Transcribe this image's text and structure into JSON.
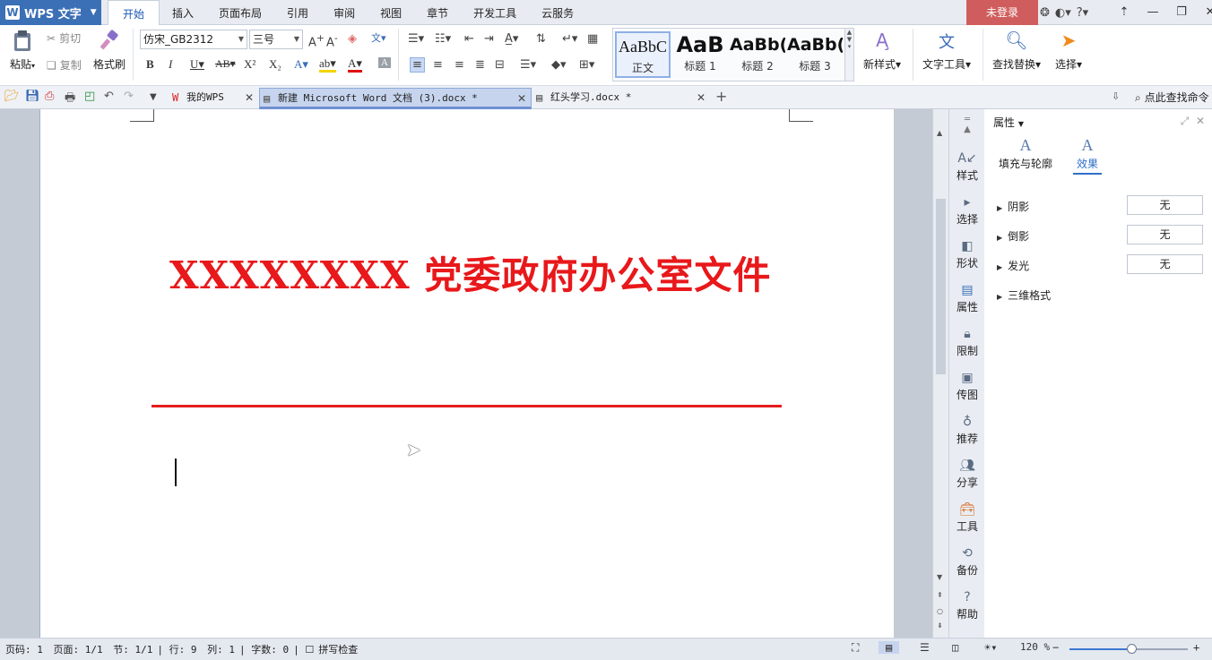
{
  "app": {
    "name": "WPS 文字"
  },
  "menu": {
    "tabs": [
      "开始",
      "插入",
      "页面布局",
      "引用",
      "审阅",
      "视图",
      "章节",
      "开发工具",
      "云服务"
    ],
    "login": "未登录"
  },
  "ribbon": {
    "paste": "粘贴",
    "cut": "剪切",
    "copy": "复制",
    "format_painter": "格式刷",
    "font_name": "仿宋_GB2312",
    "font_size": "三号",
    "styles": [
      {
        "preview": "AaBbC",
        "label": "正文"
      },
      {
        "preview": "AaB",
        "label": "标题 1"
      },
      {
        "preview": "AaBb(",
        "label": "标题 2"
      },
      {
        "preview": "AaBb(",
        "label": "标题 3"
      }
    ],
    "new_style": "新样式",
    "text_tools": "文字工具",
    "find_replace": "查找替换",
    "select": "选择"
  },
  "tabbar": {
    "docs": [
      {
        "name": "我的WPS"
      },
      {
        "name": "新建 Microsoft Word 文档 (3).docx *"
      },
      {
        "name": "红头学习.docx *"
      }
    ],
    "search_command": "点此查找命令"
  },
  "document": {
    "title": "XXXXXXXX 党委政府办公室文件",
    "title_color": "#e8181b",
    "rule_color": "#e51d1d"
  },
  "sidebar": {
    "items": [
      "样式",
      "选择",
      "形状",
      "属性",
      "限制",
      "传图",
      "推荐",
      "分享",
      "工具",
      "备份",
      "帮助"
    ]
  },
  "properties": {
    "header": "属性",
    "tabs": [
      "填充与轮廓",
      "效果"
    ],
    "rows": [
      {
        "label": "阴影",
        "value": "无"
      },
      {
        "label": "倒影",
        "value": "无"
      },
      {
        "label": "发光",
        "value": "无"
      },
      {
        "label": "三维格式",
        "value": ""
      }
    ]
  },
  "status": {
    "page_num": "页码: 1",
    "pages": "页面: 1/1",
    "section": "节: 1/1",
    "row": "行: 9",
    "col": "列: 1",
    "words": "字数: 0",
    "spell_check": "拼写检查",
    "zoom": "120 %",
    "zoom_level": 0.53
  },
  "colors": {
    "accent": "#3b6fb6",
    "login_bg": "#d05d5d"
  }
}
